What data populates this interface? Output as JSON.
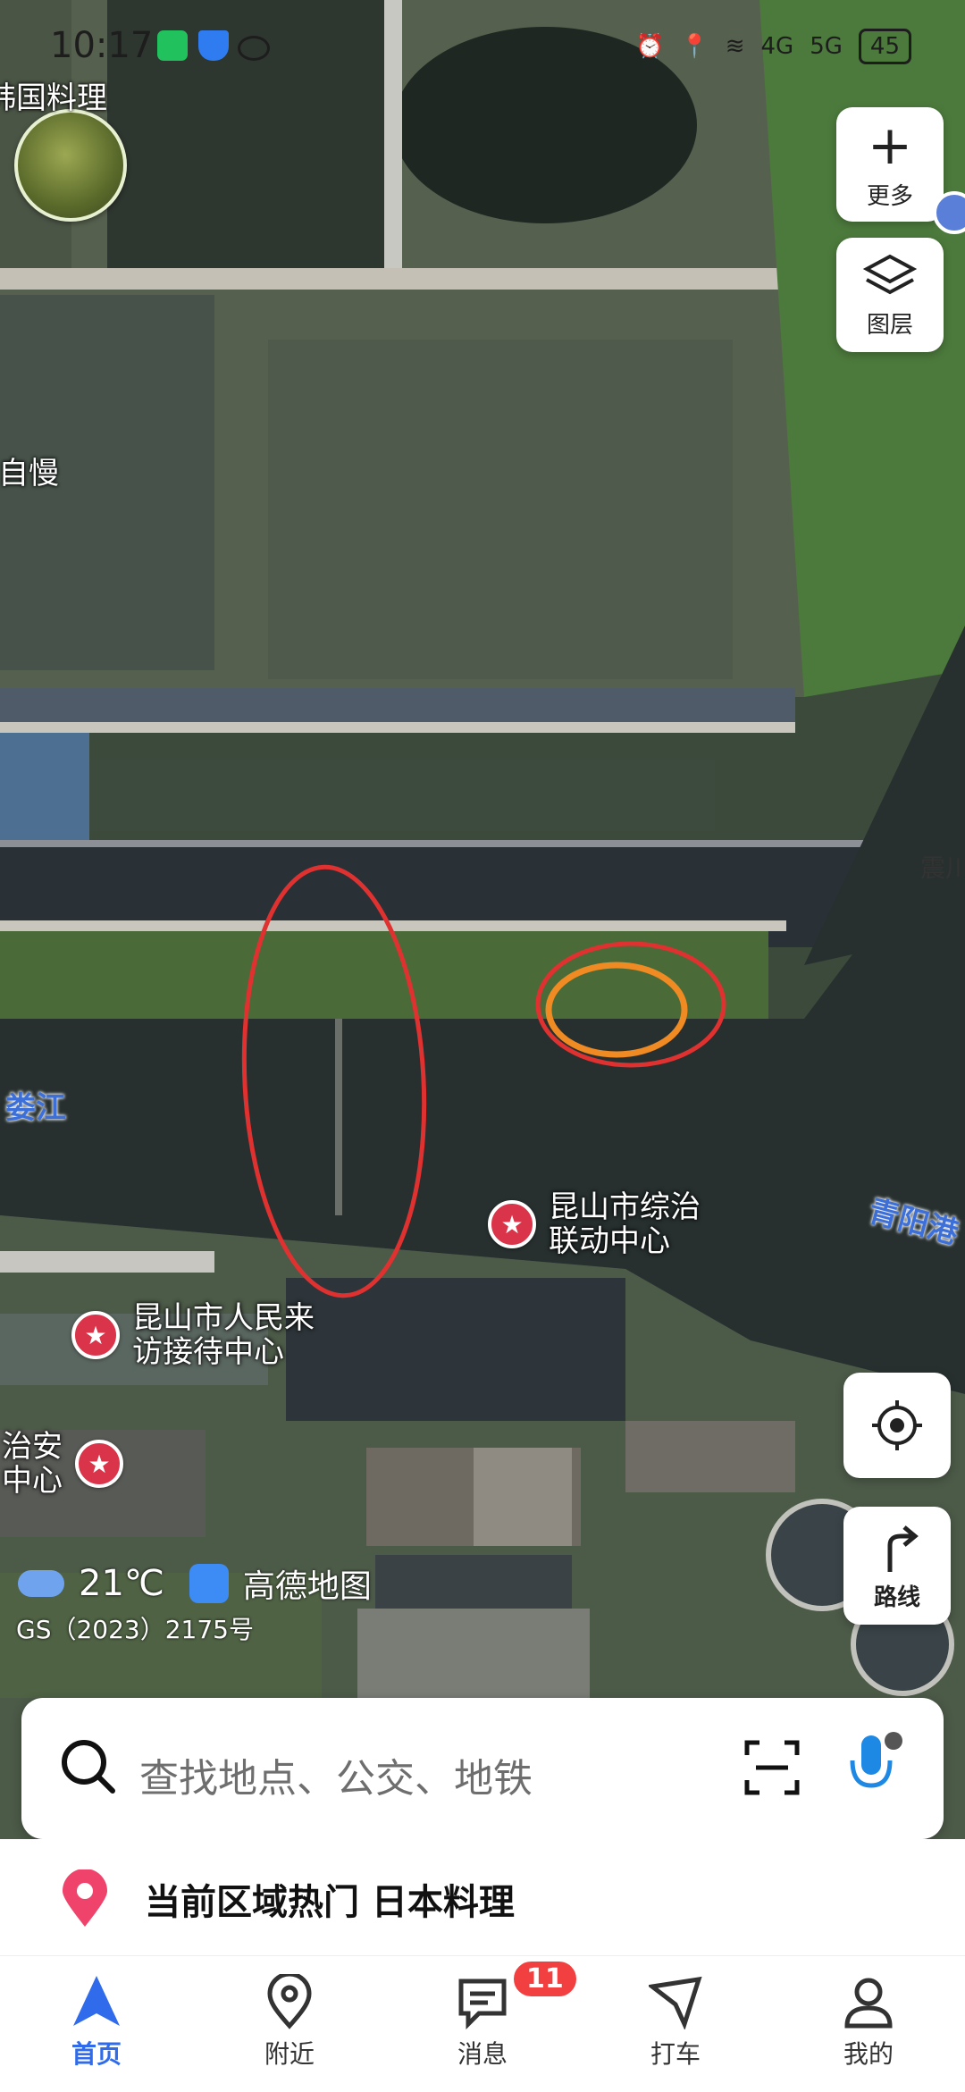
{
  "status_bar": {
    "time": "10:17",
    "net_4g": "4G",
    "net_5g": "5G",
    "battery": "45"
  },
  "map": {
    "top_left_label": "韩国料理",
    "left_label": "自慢",
    "bridge_label": "震川",
    "river_label": "娄江",
    "road_label": "青阳港",
    "pois": [
      {
        "name": "昆山市综治\n联动中心"
      },
      {
        "name": "昆山市人民来\n访接待中心"
      },
      {
        "name": "治安\n中心"
      }
    ],
    "weather_temp": "21℃",
    "brand": "高德地图",
    "license": "GS（2023）2175号"
  },
  "controls": {
    "more_label": "更多",
    "layers_label": "图层",
    "route_label": "路线"
  },
  "search": {
    "placeholder": "查找地点、公交、地铁"
  },
  "hot": {
    "text": "当前区域热门 日本料理"
  },
  "tabs": [
    {
      "label": "首页"
    },
    {
      "label": "附近"
    },
    {
      "label": "消息"
    },
    {
      "label": "打车"
    },
    {
      "label": "我的"
    }
  ],
  "messages_badge": "11",
  "colors": {
    "accent": "#2f6bea",
    "poi_red": "#d9344a",
    "badge_red": "#f23f3f",
    "annot_red": "#e03131",
    "annot_orange": "#f08a22"
  }
}
